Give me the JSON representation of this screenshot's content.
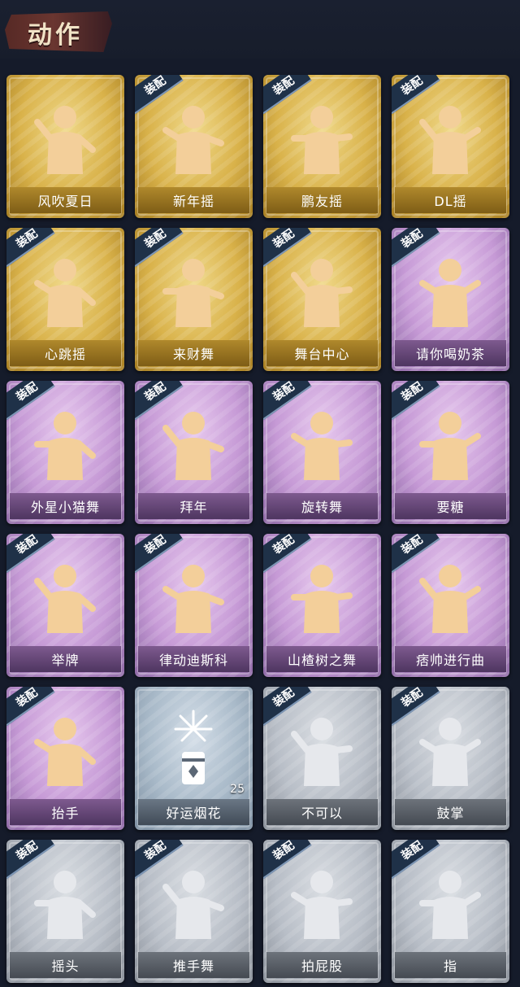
{
  "header": {
    "title": "动作"
  },
  "equip_label": "装配",
  "colors": {
    "gold": "#d9b24a",
    "purple": "#c69ad6",
    "gray": "#b8bec7",
    "blue": "#a9bac9",
    "figure_gold": "#f3cf9a",
    "figure_gray": "#e6e8ec"
  },
  "cards": [
    {
      "label": "风吹夏日",
      "rarity": "gold",
      "equipped": false,
      "icon": "wind-dance-icon"
    },
    {
      "label": "新年摇",
      "rarity": "gold",
      "equipped": true,
      "icon": "new-year-dance-icon"
    },
    {
      "label": "鹏友摇",
      "rarity": "gold",
      "equipped": true,
      "icon": "friend-dance-icon"
    },
    {
      "label": "DL摇",
      "rarity": "gold",
      "equipped": true,
      "icon": "dl-dance-icon"
    },
    {
      "label": "心跳摇",
      "rarity": "gold",
      "equipped": true,
      "icon": "heartbeat-dance-icon"
    },
    {
      "label": "来财舞",
      "rarity": "gold",
      "equipped": true,
      "icon": "fortune-dance-icon"
    },
    {
      "label": "舞台中心",
      "rarity": "gold",
      "equipped": true,
      "icon": "stage-center-icon"
    },
    {
      "label": "请你喝奶茶",
      "rarity": "purple",
      "equipped": true,
      "icon": "milk-tea-icon"
    },
    {
      "label": "外星小猫舞",
      "rarity": "purple",
      "equipped": true,
      "icon": "alien-cat-dance-icon"
    },
    {
      "label": "拜年",
      "rarity": "purple",
      "equipped": true,
      "icon": "new-year-greeting-icon"
    },
    {
      "label": "旋转舞",
      "rarity": "purple",
      "equipped": true,
      "icon": "spin-dance-icon"
    },
    {
      "label": "要糖",
      "rarity": "purple",
      "equipped": true,
      "icon": "ask-candy-icon"
    },
    {
      "label": "举牌",
      "rarity": "purple",
      "equipped": true,
      "icon": "hold-sign-icon"
    },
    {
      "label": "律动迪斯科",
      "rarity": "purple",
      "equipped": true,
      "icon": "disco-icon"
    },
    {
      "label": "山楂树之舞",
      "rarity": "purple",
      "equipped": true,
      "icon": "hawthorn-dance-icon"
    },
    {
      "label": "痞帅进行曲",
      "rarity": "purple",
      "equipped": true,
      "icon": "cool-march-icon"
    },
    {
      "label": "抬手",
      "rarity": "purple",
      "equipped": true,
      "icon": "raise-hand-icon"
    },
    {
      "label": "好运烟花",
      "rarity": "blue",
      "equipped": false,
      "icon": "firework-icon",
      "count": "25"
    },
    {
      "label": "不可以",
      "rarity": "gray",
      "equipped": true,
      "icon": "no-finger-icon"
    },
    {
      "label": "鼓掌",
      "rarity": "gray",
      "equipped": true,
      "icon": "clap-icon"
    },
    {
      "label": "摇头",
      "rarity": "gray",
      "equipped": true,
      "icon": "shake-head-icon"
    },
    {
      "label": "推手舞",
      "rarity": "gray",
      "equipped": true,
      "icon": "push-hand-dance-icon"
    },
    {
      "label": "拍屁股",
      "rarity": "gray",
      "equipped": true,
      "icon": "slap-butt-icon"
    },
    {
      "label": "指",
      "rarity": "gray",
      "equipped": true,
      "icon": "point-icon"
    }
  ]
}
